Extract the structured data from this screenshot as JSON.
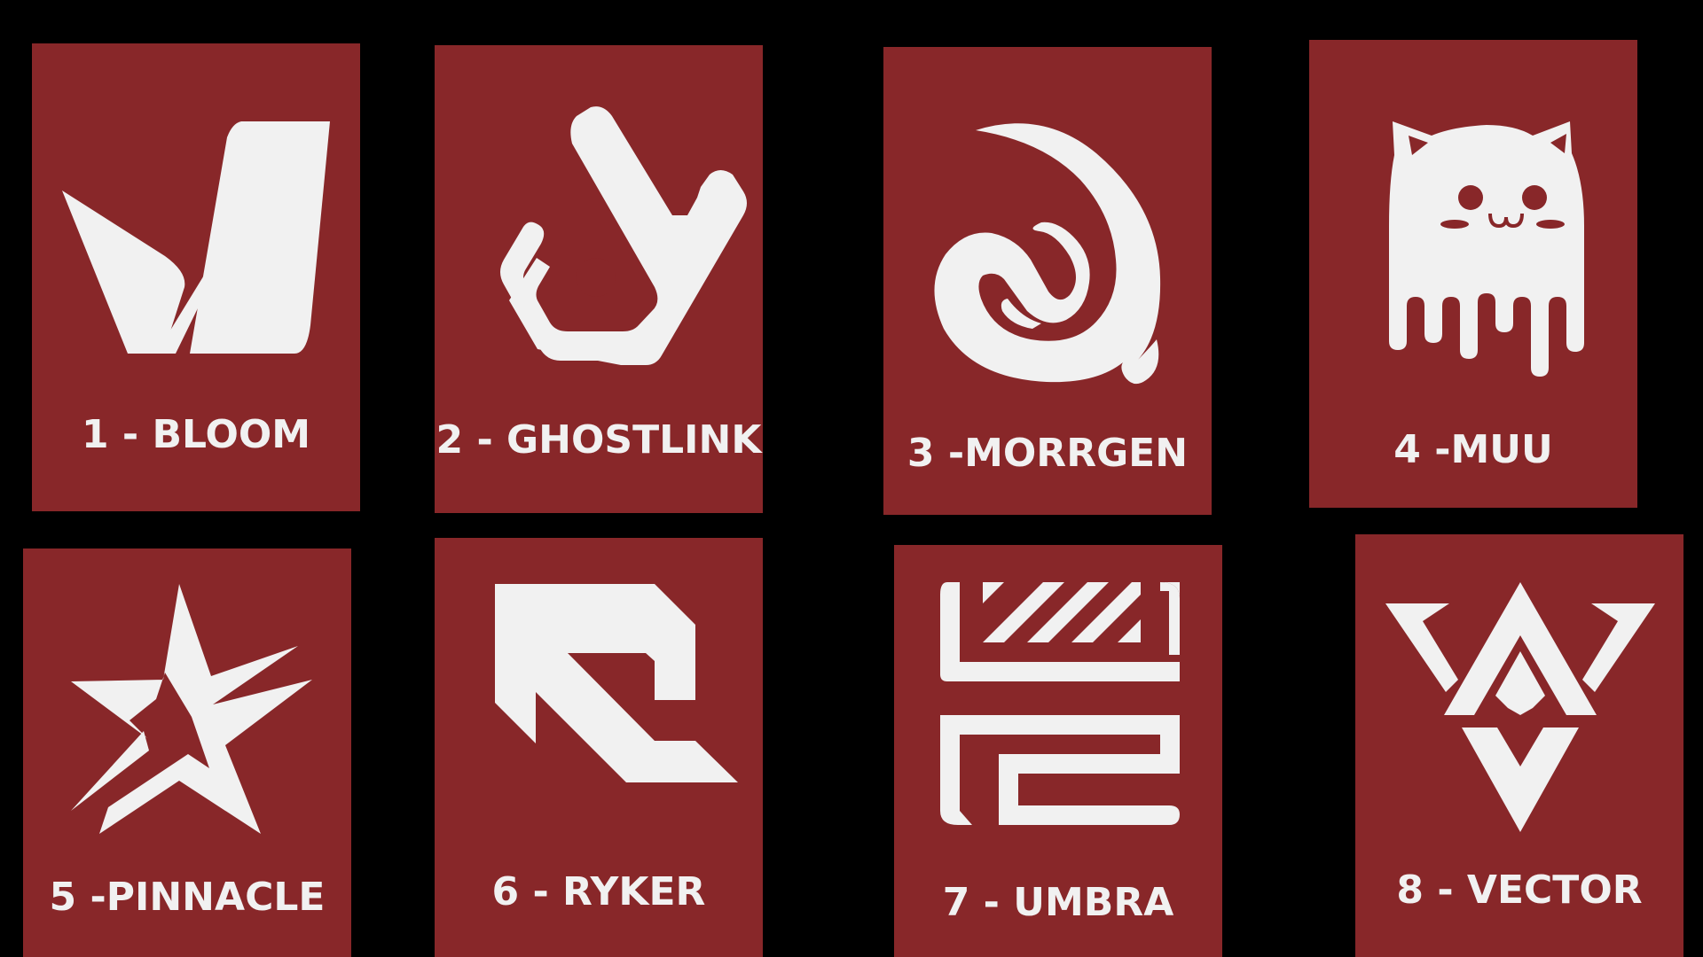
{
  "colors": {
    "background": "#000000",
    "card": "#882729",
    "foreground": "#f1f1f1"
  },
  "logos": [
    {
      "label": "1 - BLOOM",
      "icon": "bloom-leaf-icon"
    },
    {
      "label": "2 - GHOSTLINK",
      "icon": "ghostlink-hex-icon"
    },
    {
      "label": "3 -MORRGEN",
      "icon": "morrgen-swirl-icon"
    },
    {
      "label": "4 -MUU",
      "icon": "muu-cat-ghost-icon"
    },
    {
      "label": "5 -PINNACLE",
      "icon": "pinnacle-star-icon"
    },
    {
      "label": "6 - RYKER",
      "icon": "ryker-arrow-icon"
    },
    {
      "label": "7 - UMBRA",
      "icon": "umbra-maze-icon"
    },
    {
      "label": "8 - VECTOR",
      "icon": "vector-triangles-icon"
    }
  ]
}
